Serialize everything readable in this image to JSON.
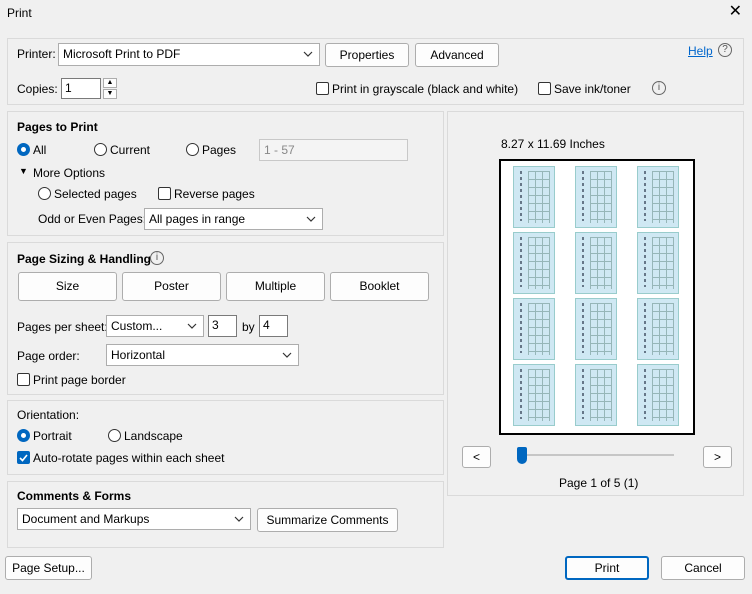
{
  "window": {
    "title": "Print",
    "close_label": "✕"
  },
  "printer": {
    "label": "Printer:",
    "selected": "Microsoft Print to PDF",
    "properties_label": "Properties",
    "advanced_label": "Advanced",
    "help_label": "Help"
  },
  "copies": {
    "label": "Copies:",
    "value": "1"
  },
  "options": {
    "grayscale_label": "Print in grayscale (black and white)",
    "grayscale_checked": false,
    "save_ink_label": "Save ink/toner",
    "save_ink_checked": false
  },
  "pages_to_print": {
    "heading": "Pages to Print",
    "all_label": "All",
    "current_label": "Current",
    "pages_label": "Pages",
    "pages_range": "1 - 57",
    "more_options_label": "More Options",
    "selected_pages_label": "Selected pages",
    "reverse_pages_label": "Reverse pages",
    "odd_even_label": "Odd or Even Pages:",
    "odd_even_selected": "All pages in range"
  },
  "sizing": {
    "heading": "Page Sizing & Handling",
    "size_label": "Size",
    "poster_label": "Poster",
    "multiple_label": "Multiple",
    "booklet_label": "Booklet",
    "pages_per_sheet_label": "Pages per sheet:",
    "pages_per_sheet_selected": "Custom...",
    "cols": "3",
    "by_label": "by",
    "rows": "4",
    "page_order_label": "Page order:",
    "page_order_selected": "Horizontal",
    "print_border_label": "Print page border"
  },
  "orientation": {
    "heading": "Orientation:",
    "portrait_label": "Portrait",
    "landscape_label": "Landscape",
    "auto_rotate_label": "Auto-rotate pages within each sheet"
  },
  "comments": {
    "heading": "Comments & Forms",
    "selected": "Document and Markups",
    "summarize_label": "Summarize Comments"
  },
  "preview": {
    "paper_size": "8.27 x 11.69 Inches",
    "prev_label": "<",
    "next_label": ">",
    "page_status": "Page 1 of 5 (1)",
    "page_progress": 0.0
  },
  "footer": {
    "page_setup_label": "Page Setup...",
    "print_label": "Print",
    "cancel_label": "Cancel"
  },
  "colors": {
    "accent": "#0067c0",
    "link": "#0066cc",
    "thumb": "#cfe8f3"
  },
  "icons": [
    "close-icon",
    "help-icon",
    "info-icon",
    "chevron-down-icon",
    "triangle-down-icon",
    "check-icon"
  ]
}
